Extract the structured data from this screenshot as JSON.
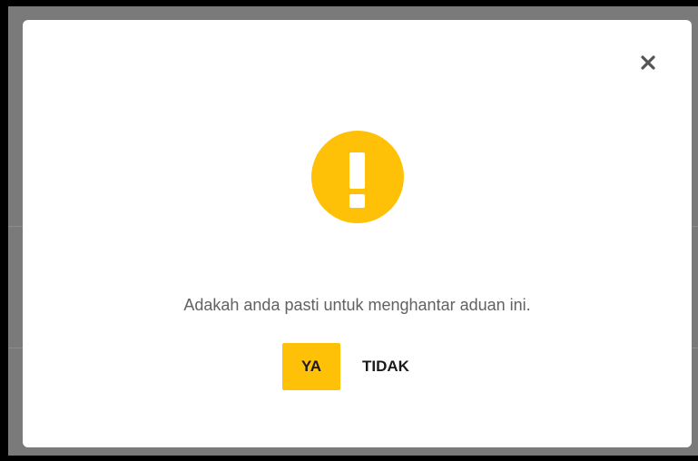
{
  "dialog": {
    "close_icon": "close-icon",
    "alert_icon": "exclamation-icon",
    "message": "Adakah anda pasti untuk menghantar aduan ini.",
    "confirm_label": "YA",
    "cancel_label": "TIDAK"
  },
  "colors": {
    "accent": "#ffc107",
    "overlay": "#7a7a7a",
    "dialog_background": "#ffffff",
    "message_text": "#616161"
  }
}
